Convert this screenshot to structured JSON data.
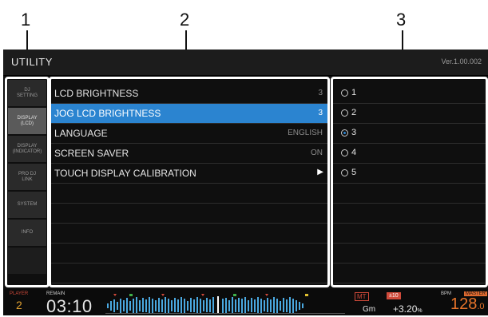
{
  "callouts": [
    "1",
    "2",
    "3"
  ],
  "window": {
    "title": "UTILITY",
    "version": "Ver.1.00.002"
  },
  "sidebar": {
    "items": [
      {
        "label": "DJ\nSETTING",
        "active": false
      },
      {
        "label": "DISPLAY\n(LCD)",
        "active": true
      },
      {
        "label": "DISPLAY\n(INDICATOR)",
        "active": false
      },
      {
        "label": "PRO DJ\nLINK",
        "active": false
      },
      {
        "label": "SYSTEM",
        "active": false
      },
      {
        "label": "INFO",
        "active": false
      }
    ]
  },
  "settings": {
    "rows": [
      {
        "label": "LCD BRIGHTNESS",
        "value": "3",
        "selected": false
      },
      {
        "label": "JOG LCD BRIGHTNESS",
        "value": "3",
        "selected": true
      },
      {
        "label": "LANGUAGE",
        "value": "ENGLISH",
        "selected": false
      },
      {
        "label": "SCREEN SAVER",
        "value": "ON",
        "selected": false
      },
      {
        "label": "TOUCH DISPLAY CALIBRATION",
        "value": "▶",
        "selected": false
      }
    ]
  },
  "options": {
    "items": [
      {
        "label": "1",
        "checked": false
      },
      {
        "label": "2",
        "checked": false
      },
      {
        "label": "3",
        "checked": true
      },
      {
        "label": "4",
        "checked": false
      },
      {
        "label": "5",
        "checked": false
      }
    ]
  },
  "status_bar": {
    "deck_label": "PLAYER",
    "deck_number": "2",
    "remain_label": "REMAIN",
    "time": "03:10",
    "mt_tag": "MT",
    "range_tag": "±10",
    "key": "Gm",
    "pitch": "+3.20",
    "pitch_unit": "%",
    "bpm_label": "BPM",
    "master_tag": "MASTER",
    "bpm": "128",
    "bpm_decimal": ".0"
  },
  "colors": {
    "accent": "#2b84d0",
    "warning": "#d04a3a",
    "bpm": "#e8742a"
  }
}
